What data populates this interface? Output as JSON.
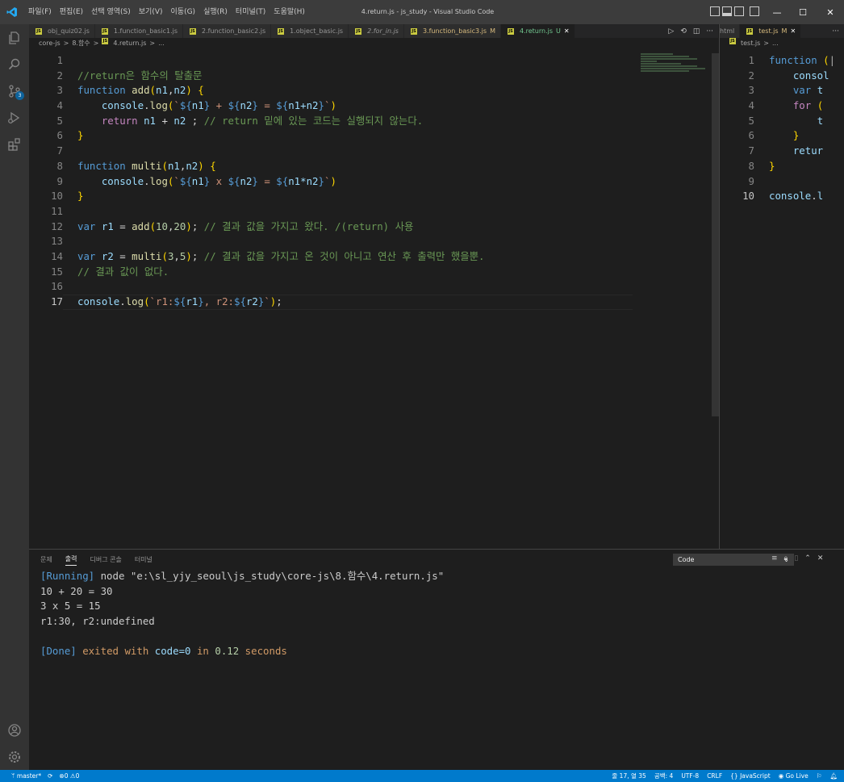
{
  "titlebar": {
    "menu": [
      "파일(F)",
      "편집(E)",
      "선택 영역(S)",
      "보기(V)",
      "이동(G)",
      "실행(R)",
      "터미널(T)",
      "도움말(H)"
    ],
    "window_title": "4.return.js - js_study - Visual Studio Code",
    "controls": {
      "minimize": "—",
      "maximize": "☐",
      "close": "✕"
    }
  },
  "left_editor": {
    "tabs": [
      {
        "label": "obj_quiz02.js",
        "modified": "",
        "active": false,
        "italic": false
      },
      {
        "label": "1.function_basic1.js",
        "modified": "",
        "active": false,
        "italic": false
      },
      {
        "label": "2.function_basic2.js",
        "modified": "",
        "active": false,
        "italic": false
      },
      {
        "label": "1.object_basic.js",
        "modified": "",
        "active": false,
        "italic": false
      },
      {
        "label": "2.for_in.js",
        "modified": "",
        "active": false,
        "italic": true
      },
      {
        "label": "3.function_basic3.js",
        "modified": "M",
        "active": false,
        "italic": false
      },
      {
        "label": "4.return.js",
        "modified": "U",
        "active": true,
        "italic": false
      }
    ],
    "breadcrumb": [
      "core-js",
      ">",
      "8.함수",
      ">",
      "4.return.js",
      ">",
      "..."
    ],
    "current_line": 17,
    "lines": [
      "",
      "//return은 함수의 탈출문",
      "function add(n1,n2) {",
      "    console.log(`${n1} + ${n2} = ${n1+n2}`)",
      "    return n1 + n2 ; // return 밑에 있는 코드는 실행되지 않는다.",
      "}",
      "",
      "function multi(n1,n2) {",
      "    console.log(`${n1} x ${n2} = ${n1*n2}`)",
      "}",
      "",
      "var r1 = add(10,20); // 결과 값을 가지고 왔다. /(return) 사용",
      "",
      "var r2 = multi(3,5); // 결과 값을 가지고 온 것이 아니고 연산 후 출력만 했을뿐.",
      "// 결과 값이 없다.",
      "",
      "console.log(`r1:${r1}, r2:${r2}`);"
    ]
  },
  "right_editor": {
    "tabs": [
      {
        "label": "html",
        "modified": ""
      },
      {
        "label": "test.js",
        "modified": "M"
      }
    ],
    "breadcrumb": [
      "test.js",
      ">",
      "..."
    ],
    "current_line": 10,
    "lines": [
      "function (",
      "    consol",
      "    var t",
      "    for (",
      "        t",
      "    }",
      "    retur",
      "}",
      "",
      "console.l"
    ]
  },
  "panel": {
    "tabs": [
      "문제",
      "출력",
      "디버그 콘솔",
      "터미널"
    ],
    "active_tab": "출력",
    "output_channel": "Code",
    "output": {
      "running_tag": "[Running]",
      "command": " node \"e:\\sl_yjy_seoul\\js_study\\core-js\\8.함수\\4.return.js\"",
      "lines": [
        "10 + 20 = 30",
        "3 x 5 = 15",
        "r1:30, r2:undefined",
        ""
      ],
      "done_tag": "[Done]",
      "done_exited": " exited with ",
      "done_code": "code=0",
      "done_in": " in ",
      "done_time": "0.12",
      "done_seconds": " seconds"
    }
  },
  "statusbar": {
    "branch": "master*",
    "errors": "0",
    "warnings": "0",
    "position": "줄 17, 열 35",
    "spaces": "공백: 4",
    "encoding": "UTF-8",
    "eol": "CRLF",
    "language": "JavaScript",
    "golive": "Go Live"
  },
  "colors": {
    "activity_bar": "#333333",
    "status_bar": "#007acc",
    "editor_bg": "#1e1e1e",
    "keyword": "#569cd6",
    "function": "#dcdcaa",
    "variable": "#9cdcfe",
    "number": "#b5cea8",
    "string": "#ce9178",
    "comment": "#6a9955"
  }
}
